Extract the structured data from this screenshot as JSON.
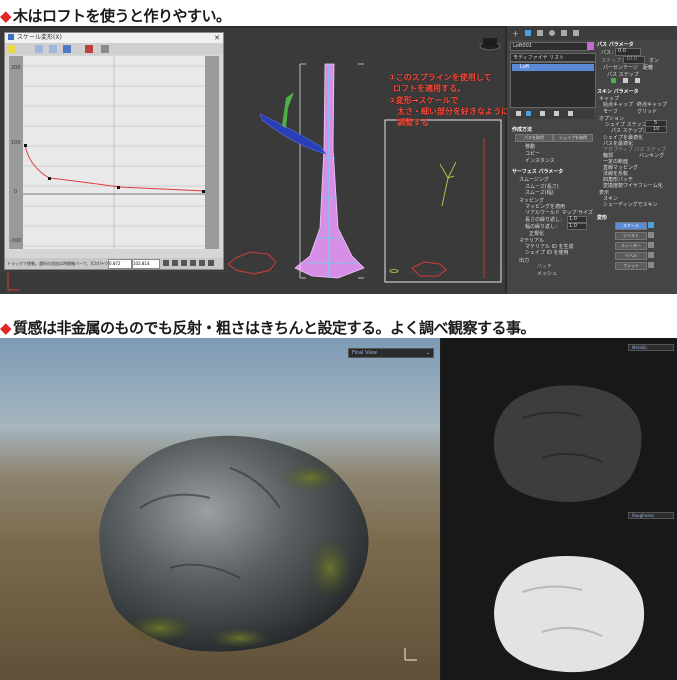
{
  "headings": {
    "top": "木はロフトを使うと作りやすい。",
    "bottom": "質感は非金属のものでも反射・粗さはきちんと設定する。よく調べ観察する事。"
  },
  "curve_editor": {
    "title": "スケール変形(X)",
    "y_ticks": [
      "200",
      "100",
      "0",
      "-100"
    ],
    "status": "ドラッグで移動。選択の追加は時間軸バーで、[Ctrl]+クリックで選択",
    "field1": "0.872",
    "field2": "102.814"
  },
  "annotation": {
    "line1": "①このスプラインを使用して",
    "line2": "ロフトを適用する。",
    "line3": "②変形→スケールで",
    "line4": "太さ・細い部分を好きなように",
    "line5": "調整する"
  },
  "side_panel": {
    "object_name": "Loft001",
    "modifier_list": "モディファイヤ リスト",
    "stack_item": "Loft",
    "path_params": "パス パラメータ",
    "path_label": "パス：",
    "path_value": "0.0",
    "snap_label": "スナップ：",
    "snap_value": "10.0",
    "on": "オン",
    "percent": "パーセンテージ",
    "distance": "距離",
    "path_steps": "パス ステップ",
    "skin_params": "スキン パラメータ",
    "capping": "キャップ",
    "cap_start": "始点キャップ",
    "cap_end": "終点キャップ",
    "morph": "モーフ",
    "grid": "グリッド",
    "options": "オプション",
    "shape_steps": "シェイプ ステップ：",
    "shape_steps_val": "5",
    "path_steps_lbl": "パス ステップ：",
    "path_steps_val": "10",
    "opts": [
      "シェイプを最適化",
      "パスを最適化",
      "アダプティブ パス ステップ",
      "輪郭",
      "バンキング",
      "一定の断面",
      "直線マッピング",
      "法線を反転",
      "四角形パッチ",
      "変換度数ワイヤフレーム化"
    ],
    "display": "表示",
    "skin": "スキン",
    "shading": "シェーディングでスキン",
    "creation": "作成方法",
    "get_path": "パスを取得",
    "get_shape": "シェイプを取得",
    "move": "移動",
    "copy": "コピー",
    "instance": "インスタンス",
    "surface": "サーフェス パラメータ",
    "smoothing": "スムージング",
    "smooth_len": "スムーズ(長さ)",
    "smooth_wid": "スムーズ(幅)",
    "mapping": "マッピング",
    "apply_map": "マッピングを適用",
    "real_world": "リアルワールド マップ サイズ",
    "length_rep": "長さの繰り返し：",
    "width_rep": "幅の繰り返し：",
    "normalize": "正規化",
    "material": "マテリアル",
    "gen_mat": "マテリアル ID を生成",
    "use_shape": "シェイプ ID を使用",
    "output": "出力",
    "patch": "パッチ",
    "mesh": "メッシュ",
    "deform": "変形",
    "scale": "スケール",
    "twist": "ツイスト",
    "teeter": "ティーター",
    "bevel": "ベベル",
    "fit": "フィット",
    "rep_val": "1.0"
  },
  "bottom": {
    "dropdown_main": "Final View",
    "dropdown_metal": "Metallic",
    "dropdown_rough": "Roughness"
  },
  "colors": {
    "heading_diamond": "#e0261e",
    "annotation": "#ff4d3d",
    "loft_surface": "#d68ee6",
    "spline": "#6ad2e8",
    "branch_blue": "#2a3fb8",
    "branch_green": "#4fb04a"
  }
}
